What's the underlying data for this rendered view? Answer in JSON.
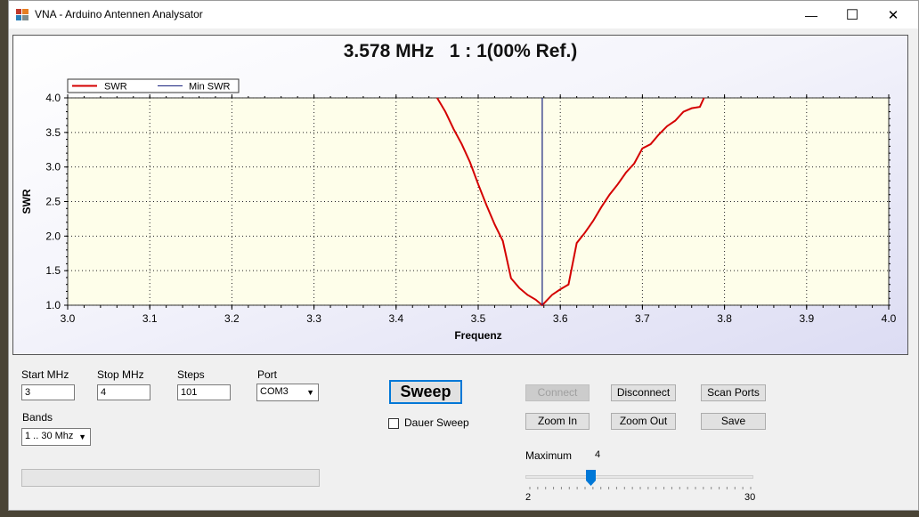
{
  "window": {
    "title": "VNA - Arduino Antennen Analysator",
    "minimize_symbol": "—",
    "maximize_symbol": "☐",
    "close_symbol": "✕"
  },
  "chart": {
    "header": "3.578 MHz   1 : 1(00% Ref.)",
    "legend": [
      "SWR",
      "Min SWR"
    ]
  },
  "chart_data": {
    "type": "line",
    "title": "3.578 MHz   1 : 1(00% Ref.)",
    "xlabel": "Frequenz",
    "ylabel": "SWR",
    "xlim": [
      3.0,
      4.0
    ],
    "ylim": [
      1.0,
      4.0
    ],
    "xticks": [
      "3.0",
      "3.1",
      "3.2",
      "3.3",
      "3.4",
      "3.5",
      "3.6",
      "3.7",
      "3.8",
      "3.9",
      "4.0"
    ],
    "yticks": [
      "1.0",
      "1.5",
      "2.0",
      "2.5",
      "3.0",
      "3.5",
      "4.0"
    ],
    "grid": true,
    "legend_position": "top-left",
    "series": [
      {
        "name": "SWR",
        "color": "#d40000",
        "x": [
          3.45,
          3.46,
          3.47,
          3.48,
          3.49,
          3.5,
          3.51,
          3.52,
          3.53,
          3.54,
          3.55,
          3.56,
          3.57,
          3.578,
          3.59,
          3.6,
          3.61,
          3.62,
          3.63,
          3.64,
          3.65,
          3.66,
          3.67,
          3.68,
          3.69,
          3.7,
          3.71,
          3.72,
          3.73,
          3.74,
          3.75,
          3.76,
          3.77,
          3.775
        ],
        "y": [
          4.0,
          3.8,
          3.55,
          3.33,
          3.07,
          2.75,
          2.45,
          2.17,
          1.93,
          1.39,
          1.25,
          1.15,
          1.08,
          1.0,
          1.15,
          1.23,
          1.3,
          1.9,
          2.05,
          2.22,
          2.42,
          2.6,
          2.75,
          2.92,
          3.05,
          3.27,
          3.33,
          3.47,
          3.59,
          3.67,
          3.8,
          3.85,
          3.87,
          4.0
        ]
      },
      {
        "name": "Min SWR",
        "color": "#1a237e",
        "x": [
          3.578,
          3.578
        ],
        "y": [
          1.0,
          4.0
        ]
      }
    ]
  },
  "controls": {
    "start_label": "Start MHz",
    "start_value": "3",
    "stop_label": "Stop MHz",
    "stop_value": "4",
    "steps_label": "Steps",
    "steps_value": "101",
    "port_label": "Port",
    "port_value": "COM3",
    "bands_label": "Bands",
    "bands_value": "1 .. 30 Mhz",
    "sweep_label": "Sweep",
    "dauer_label": "Dauer Sweep",
    "connect_label": "Connect",
    "disconnect_label": "Disconnect",
    "scan_label": "Scan Ports",
    "zoomin_label": "Zoom In",
    "zoomout_label": "Zoom Out",
    "save_label": "Save",
    "maximum_label": "Maximum",
    "maximum_value": "4",
    "slider_min": "2",
    "slider_max": "30",
    "slider_value": 4
  },
  "colors": {
    "swr_line": "#d40000",
    "marker_line": "#1a237e",
    "plot_background": "#fefeea",
    "accent": "#0078d7"
  },
  "icons": {
    "app": "vna-app-icon",
    "dropdown": "chevron-down-icon"
  }
}
